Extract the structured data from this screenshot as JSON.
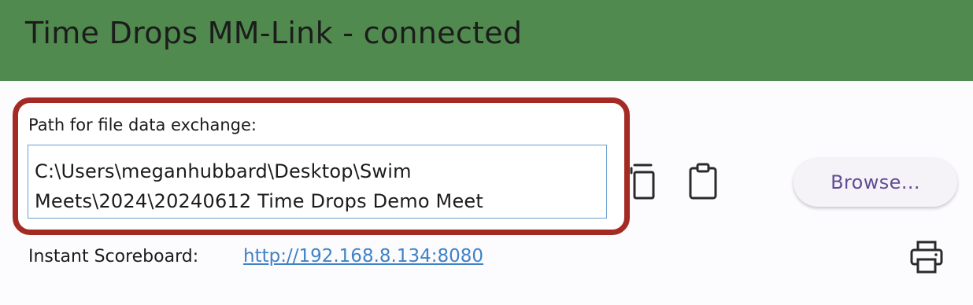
{
  "window": {
    "title": "Time Drops MM-Link - connected"
  },
  "path_panel": {
    "label": "Path for file data exchange:",
    "value_line1": "C:\\Users\\meganhubbard\\Desktop\\Swim",
    "value_line2": "Meets\\2024\\20240612 Time Drops Demo Meet"
  },
  "actions": {
    "copy_icon": "copy-icon",
    "paste_icon": "clipboard-icon",
    "browse_label": "Browse..."
  },
  "scoreboard": {
    "label": "Instant Scoreboard:",
    "url": "http://192.168.8.134:8080",
    "print_icon": "printer-icon"
  },
  "colors": {
    "title_bar": "#508a4e",
    "highlight_border": "#a42b24",
    "input_border": "#6a9fd0",
    "link": "#3f82c7",
    "browse_text": "#5e4d94"
  }
}
